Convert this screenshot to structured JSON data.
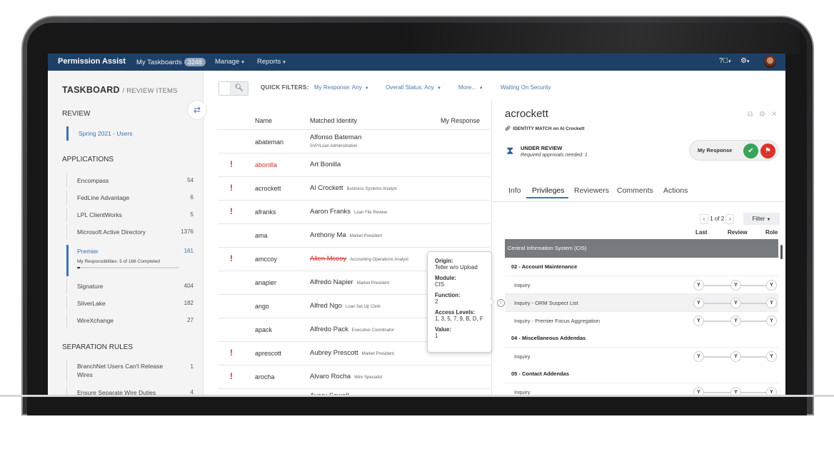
{
  "topbar": {
    "brand": "Permission Assist",
    "nav_taskboards": "My Taskboards",
    "taskboards_count": "3248",
    "nav_manage": "Manage",
    "nav_reports": "Reports"
  },
  "sidebar": {
    "title": "TASKBOARD",
    "subtitle": "/ REVIEW ITEMS",
    "review_heading": "REVIEW",
    "review_item": "Spring 2021 - Users",
    "applications_heading": "APPLICATIONS",
    "applications": [
      {
        "label": "Encompass",
        "count": "54"
      },
      {
        "label": "FedLine Advantage",
        "count": "6"
      },
      {
        "label": "LPL ClientWorks",
        "count": "5"
      },
      {
        "label": "Microsoft Active Directory",
        "count": "1376"
      }
    ],
    "selected_app": {
      "label": "Premier",
      "count": "161",
      "responsibilities": "My Responsibilities: 5 of 166 Completed",
      "progress_fraction": 0.03
    },
    "applications_after": [
      {
        "label": "Signature",
        "count": "404"
      },
      {
        "label": "SilverLake",
        "count": "182"
      },
      {
        "label": "WireXchange",
        "count": "27"
      }
    ],
    "separation_heading": "SEPARATION RULES",
    "separation_rules": [
      {
        "label": "BranchNet Users Can't Release Wires",
        "count": "1"
      },
      {
        "label": "Ensure Separate Wire Duties",
        "count": "4"
      }
    ]
  },
  "filters": {
    "label": "QUICK FILTERS:",
    "my_response": "My Response: Any",
    "overall_status": "Overall Status: Any",
    "more": "More...",
    "waiting": "Waiting On Security"
  },
  "table": {
    "col_name": "Name",
    "col_identity": "Matched Identity",
    "col_response": "My Response",
    "rows": [
      {
        "name": "abateman",
        "identity": "Alfonso Bateman",
        "title": "SVP/Loan Administration",
        "flag": ""
      },
      {
        "name": "abonilla",
        "identity": "Art Bonilla",
        "title": "",
        "flag": "!"
      },
      {
        "name": "acrockett",
        "identity": "Al Crockett",
        "title": "Business Systems Analyst",
        "flag": "!"
      },
      {
        "name": "afranks",
        "identity": "Aaron Franks",
        "title": "Loan File Review",
        "flag": "!"
      },
      {
        "name": "ama",
        "identity": "Anthony Ma",
        "title": "Market President",
        "flag": ""
      },
      {
        "name": "amccoy",
        "identity": "Allen Mccoy",
        "title": "Accounting Operations Analyst",
        "flag": "!"
      },
      {
        "name": "anapier",
        "identity": "Alfredo Napier",
        "title": "Market President",
        "flag": ""
      },
      {
        "name": "ango",
        "identity": "Alfred Ngo",
        "title": "Loan Set Up Clerk",
        "flag": ""
      },
      {
        "name": "apack",
        "identity": "Alfredo Pack",
        "title": "Executive Coordinator",
        "flag": ""
      },
      {
        "name": "aprescott",
        "identity": "Aubrey Prescott",
        "title": "Market President",
        "flag": "!"
      },
      {
        "name": "arocha",
        "identity": "Alvaro Rocha",
        "title": "Wire Specialist",
        "flag": "!"
      },
      {
        "name": "",
        "identity": "Avery Sewell",
        "title": "",
        "flag": "!"
      }
    ]
  },
  "tooltip": {
    "origin_label": "Origin:",
    "origin": "Teller w/o Upload",
    "module_label": "Module:",
    "module": "CIS",
    "function_label": "Function:",
    "function": "2",
    "access_label": "Access Levels:",
    "access": "1, 3, 5, 7, 9, B, D, F",
    "value_label": "Value:",
    "value": "1"
  },
  "panel": {
    "username": "acrockett",
    "match_text": "IDENTITY MATCH on Al Crockett",
    "status": "UNDER REVIEW",
    "required": "Required approvals needed: 1",
    "my_response": "My Response",
    "tabs": [
      "Info",
      "Privileges",
      "Reviewers",
      "Comments",
      "Actions"
    ],
    "pager": "1 of 2",
    "filter": "Filter",
    "cols": [
      "Last",
      "Review",
      "Role"
    ],
    "system": "Central Information System (CIS)",
    "sections": [
      {
        "title": "02 - Account Maintenance",
        "items": [
          "Inquiry",
          "Inquiry - ORM Suspect List",
          "Inquiry - Premier Focus Aggregation"
        ]
      },
      {
        "title": "04 - Miscellaneous Addendas",
        "items": [
          "Inquiry"
        ]
      },
      {
        "title": "05 - Contact Addendas",
        "items": [
          "Inquiry"
        ]
      }
    ],
    "y_label": "Y"
  },
  "colors": {
    "nav": "#1e4066",
    "accent": "#3a74b5",
    "flag": "#d0342c",
    "approve": "#3aa35a",
    "reject": "#d9342b"
  },
  "icons": [
    "search-icon",
    "swap-icon",
    "help-icon",
    "gear-icon",
    "link-icon",
    "hourglass-icon",
    "check-icon",
    "flag-icon",
    "info-icon",
    "external-link-icon",
    "close-icon"
  ]
}
